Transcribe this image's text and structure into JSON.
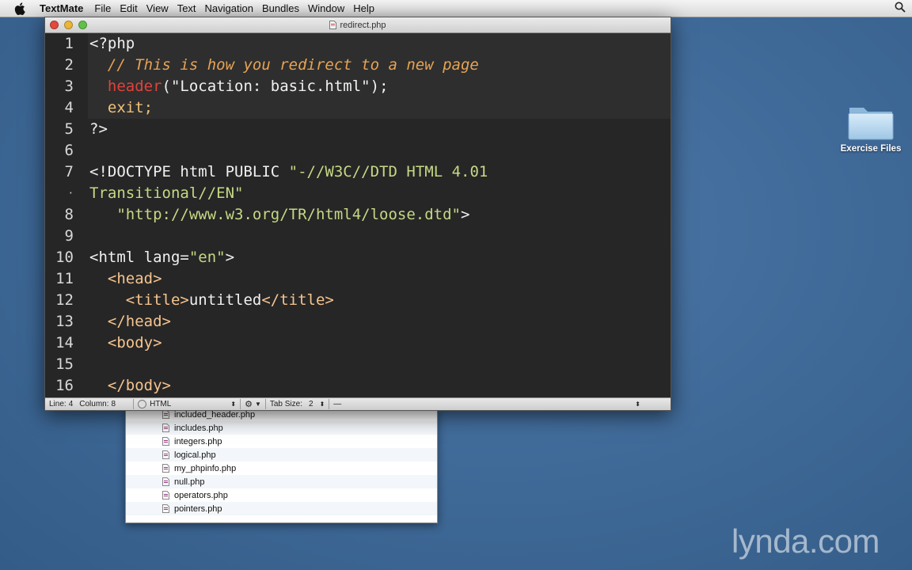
{
  "menubar": {
    "app_name": "TextMate",
    "items": [
      "File",
      "Edit",
      "View",
      "Text",
      "Navigation",
      "Bundles",
      "Window",
      "Help"
    ]
  },
  "window": {
    "title": "redirect.php"
  },
  "editor": {
    "line_numbers": [
      "1",
      "2",
      "3",
      "4",
      "5",
      "6",
      "7",
      "·",
      "8",
      "9",
      "10",
      "11",
      "12",
      "13",
      "14",
      "15",
      "16"
    ],
    "lines": [
      [
        {
          "t": "<?php",
          "c": "plain"
        }
      ],
      [
        {
          "t": "  // This is how you redirect to a new page",
          "c": "comment"
        }
      ],
      [
        {
          "t": "  header",
          "c": "fn"
        },
        {
          "t": "(",
          "c": "plain"
        },
        {
          "t": "\"Location: basic.html\"",
          "c": "plain"
        },
        {
          "t": ");",
          "c": "plain"
        }
      ],
      [
        {
          "t": "  exit;",
          "c": "kw"
        }
      ],
      [
        {
          "t": "?>",
          "c": "plain"
        }
      ],
      [
        {
          "t": "",
          "c": "plain"
        }
      ],
      [
        {
          "t": "<!DOCTYPE html PUBLIC ",
          "c": "plain"
        },
        {
          "t": "\"-//W3C//DTD HTML 4.01",
          "c": "str"
        }
      ],
      [
        {
          "t": "Transitional//EN\"",
          "c": "str"
        }
      ],
      [
        {
          "t": "   \"http://www.w3.org/TR/html4/loose.dtd\"",
          "c": "str"
        },
        {
          "t": ">",
          "c": "plain"
        }
      ],
      [
        {
          "t": "",
          "c": "plain"
        }
      ],
      [
        {
          "t": "<html lang=",
          "c": "plain"
        },
        {
          "t": "\"en\"",
          "c": "str"
        },
        {
          "t": ">",
          "c": "plain"
        }
      ],
      [
        {
          "t": "  <head>",
          "c": "tag"
        }
      ],
      [
        {
          "t": "    <title>",
          "c": "tag"
        },
        {
          "t": "untitled",
          "c": "plain"
        },
        {
          "t": "</title>",
          "c": "tag"
        }
      ],
      [
        {
          "t": "  </head>",
          "c": "tag"
        }
      ],
      [
        {
          "t": "  <body>",
          "c": "tag"
        }
      ],
      [
        {
          "t": "",
          "c": "plain"
        }
      ],
      [
        {
          "t": "  </body>",
          "c": "tag"
        }
      ]
    ]
  },
  "statusbar": {
    "line_label": "Line:",
    "line_value": "4",
    "column_label": "Column:",
    "column_value": "8",
    "language": "HTML",
    "tab_size_label": "Tab Size:",
    "tab_size_value": "2"
  },
  "drawer": {
    "files": [
      "included_header.php",
      "includes.php",
      "integers.php",
      "logical.php",
      "my_phpinfo.php",
      "null.php",
      "operators.php",
      "pointers.php"
    ]
  },
  "desktop": {
    "folder_label": "Exercise Files"
  },
  "watermark": "lynda.com"
}
